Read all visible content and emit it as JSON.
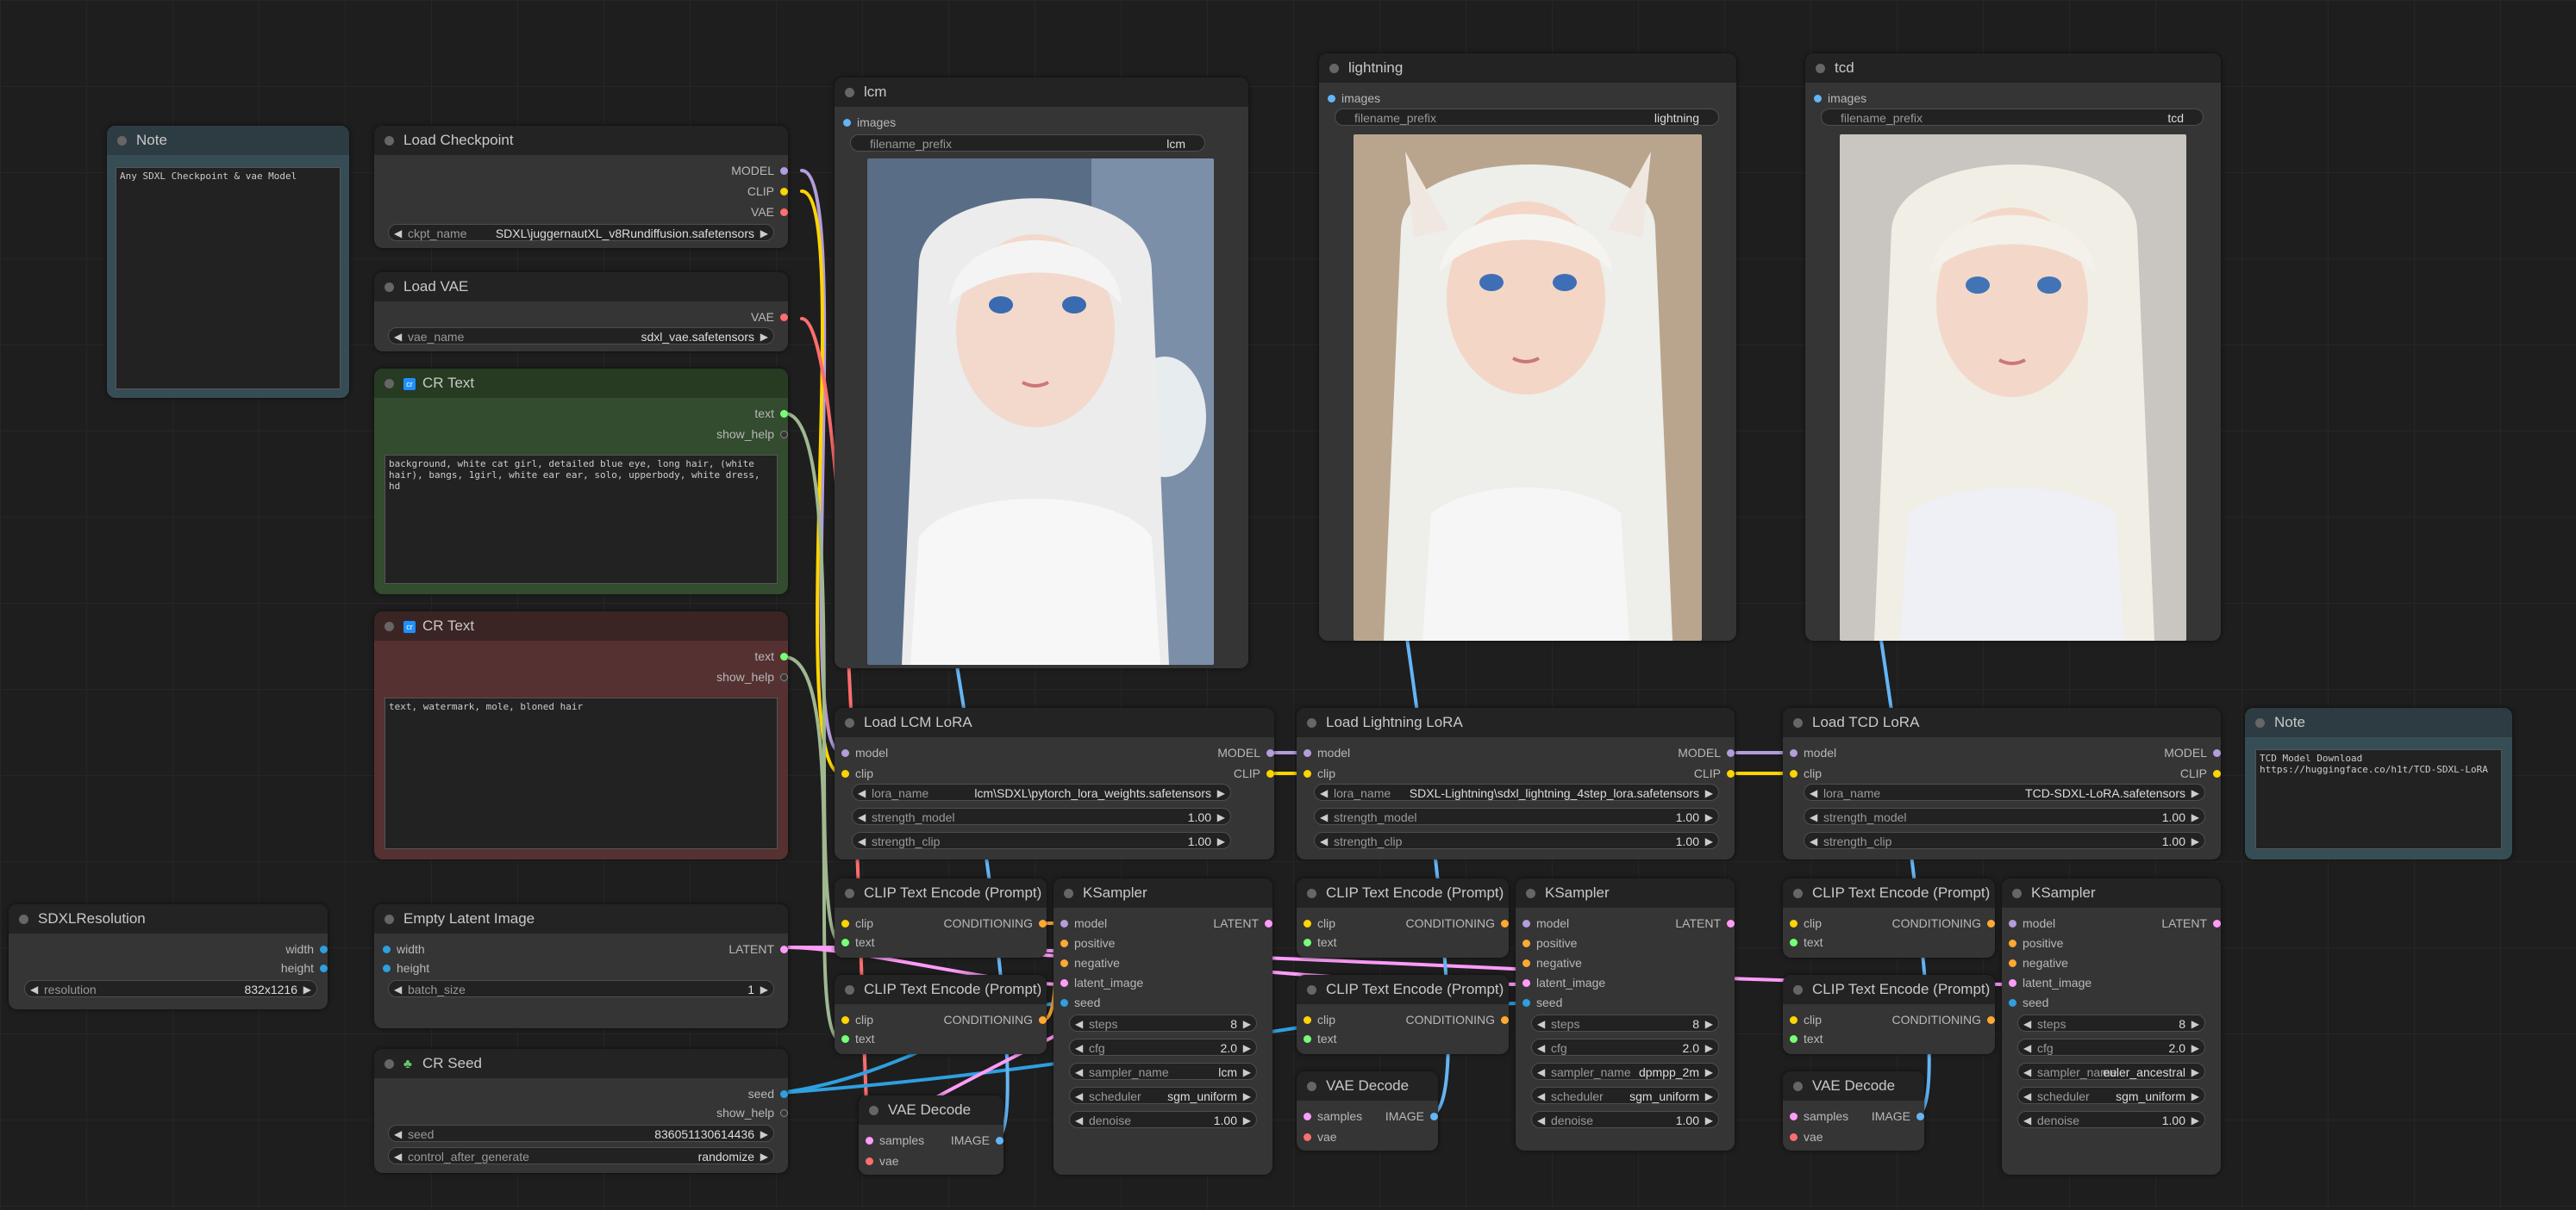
{
  "nodes": {
    "note1": {
      "title": "Note",
      "text": "Any SDXL Checkpoint & vae Model"
    },
    "ckpt": {
      "title": "Load Checkpoint",
      "out_model": "MODEL",
      "out_clip": "CLIP",
      "out_vae": "VAE",
      "w_label": "ckpt_name",
      "w_value": "SDXL\\juggernautXL_v8Rundiffusion.safetensors"
    },
    "vae": {
      "title": "Load VAE",
      "out_vae": "VAE",
      "w_label": "vae_name",
      "w_value": "sdxl_vae.safetensors"
    },
    "pos": {
      "title": "CR Text",
      "out_text": "text",
      "out_help": "show_help",
      "text": "background, white cat girl, detailed blue eye, long hair, (white hair), bangs, 1girl, white ear ear, solo, upperbody, white dress, hd"
    },
    "neg": {
      "title": "CR Text",
      "out_text": "text",
      "out_help": "show_help",
      "text": "text, watermark, mole, bloned hair"
    },
    "res": {
      "title": "SDXLResolution",
      "out_w": "width",
      "out_h": "height",
      "w_label": "resolution",
      "w_value": "832x1216"
    },
    "latent": {
      "title": "Empty Latent Image",
      "in_w": "width",
      "in_h": "height",
      "out_latent": "LATENT",
      "w_label": "batch_size",
      "w_value": "1"
    },
    "seed": {
      "title": "CR Seed",
      "out_seed": "seed",
      "out_help": "show_help",
      "w1_label": "seed",
      "w1_value": "836051130614436",
      "w2_label": "control_after_generate",
      "w2_value": "randomize"
    },
    "save_lcm": {
      "title": "lcm",
      "in": "images",
      "w_label": "filename_prefix",
      "w_value": "lcm"
    },
    "save_light": {
      "title": "lightning",
      "in": "images",
      "w_label": "filename_prefix",
      "w_value": "lightning"
    },
    "save_tcd": {
      "title": "tcd",
      "in": "images",
      "w_label": "filename_prefix",
      "w_value": "tcd"
    },
    "lora_lcm": {
      "title": "Load LCM LoRA",
      "in_model": "model",
      "in_clip": "clip",
      "out_model": "MODEL",
      "out_clip": "CLIP",
      "l1": "lora_name",
      "v1": "lcm\\SDXL\\pytorch_lora_weights.safetensors",
      "l2": "strength_model",
      "v2": "1.00",
      "l3": "strength_clip",
      "v3": "1.00"
    },
    "lora_light": {
      "title": "Load Lightning LoRA",
      "in_model": "model",
      "in_clip": "clip",
      "out_model": "MODEL",
      "out_clip": "CLIP",
      "l1": "lora_name",
      "v1": "SDXL-Lightning\\sdxl_lightning_4step_lora.safetensors",
      "l2": "strength_model",
      "v2": "1.00",
      "l3": "strength_clip",
      "v3": "1.00"
    },
    "lora_tcd": {
      "title": "Load TCD LoRA",
      "in_model": "model",
      "in_clip": "clip",
      "out_model": "MODEL",
      "out_clip": "CLIP",
      "l1": "lora_name",
      "v1": "TCD-SDXL-LoRA.safetensors",
      "l2": "strength_model",
      "v2": "1.00",
      "l3": "strength_clip",
      "v3": "1.00"
    },
    "note2": {
      "title": "Note",
      "text": "TCD Model Download\nhttps://huggingface.co/h1t/TCD-SDXL-LoRA"
    },
    "clip_label": {
      "title": "CLIP Text Encode (Prompt)",
      "in_clip": "clip",
      "in_text": "text",
      "out": "CONDITIONING"
    },
    "ks_lcm": {
      "title": "KSampler",
      "out": "LATENT",
      "in_model": "model",
      "in_pos": "positive",
      "in_neg": "negative",
      "in_lat": "latent_image",
      "in_seed": "seed",
      "steps": "8",
      "cfg": "2.0",
      "sampler": "lcm",
      "scheduler": "sgm_uniform",
      "denoise": "1.00"
    },
    "ks_light": {
      "title": "KSampler",
      "out": "LATENT",
      "in_model": "model",
      "in_pos": "positive",
      "in_neg": "negative",
      "in_lat": "latent_image",
      "in_seed": "seed",
      "steps": "8",
      "cfg": "2.0",
      "sampler": "dpmpp_2m",
      "scheduler": "sgm_uniform",
      "denoise": "1.00"
    },
    "ks_tcd": {
      "title": "KSampler",
      "out": "LATENT",
      "in_model": "model",
      "in_pos": "positive",
      "in_neg": "negative",
      "in_lat": "latent_image",
      "in_seed": "seed",
      "steps": "8",
      "cfg": "2.0",
      "sampler": "euler_ancestral",
      "scheduler": "sgm_uniform",
      "denoise": "1.00"
    },
    "ks_labels": {
      "steps": "steps",
      "cfg": "cfg",
      "sampler": "sampler_name",
      "scheduler": "scheduler",
      "denoise": "denoise"
    },
    "vae_decode": {
      "title": "VAE Decode",
      "in_samples": "samples",
      "in_vae": "vae",
      "out": "IMAGE"
    }
  },
  "colors": {
    "model": "#b39ddb",
    "clip": "#ffd500",
    "vae": "#ff6e6e",
    "text": "#77ff77",
    "conditioning": "#ffa931",
    "latent": "#ff9cf9",
    "image": "#64b5f6",
    "int": "#2f9fdf"
  }
}
